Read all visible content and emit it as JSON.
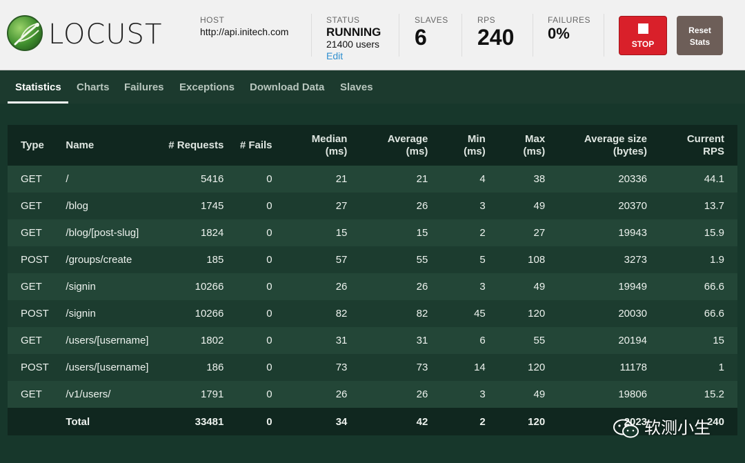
{
  "header": {
    "app_name": "LOCUST",
    "host": {
      "label": "HOST",
      "value": "http://api.initech.com"
    },
    "status": {
      "label": "STATUS",
      "state": "RUNNING",
      "users": "21400 users",
      "edit_label": "Edit"
    },
    "slaves": {
      "label": "SLAVES",
      "value": "6"
    },
    "rps": {
      "label": "RPS",
      "value": "240"
    },
    "failures": {
      "label": "FAILURES",
      "value": "0%"
    },
    "stop_label": "STOP",
    "reset_label_line1": "Reset",
    "reset_label_line2": "Stats"
  },
  "tabs": [
    {
      "label": "Statistics",
      "active": true
    },
    {
      "label": "Charts"
    },
    {
      "label": "Failures"
    },
    {
      "label": "Exceptions"
    },
    {
      "label": "Download Data"
    },
    {
      "label": "Slaves"
    }
  ],
  "table": {
    "columns": [
      {
        "line1": "Type",
        "line2": ""
      },
      {
        "line1": "Name",
        "line2": ""
      },
      {
        "line1": "# Requests",
        "line2": ""
      },
      {
        "line1": "# Fails",
        "line2": ""
      },
      {
        "line1": "Median",
        "line2": "(ms)"
      },
      {
        "line1": "Average",
        "line2": "(ms)"
      },
      {
        "line1": "Min",
        "line2": "(ms)"
      },
      {
        "line1": "Max",
        "line2": "(ms)"
      },
      {
        "line1": "Average size",
        "line2": "(bytes)"
      },
      {
        "line1": "Current",
        "line2": "RPS"
      }
    ],
    "rows": [
      [
        "GET",
        "/",
        "5416",
        "0",
        "21",
        "21",
        "4",
        "38",
        "20336",
        "44.1"
      ],
      [
        "GET",
        "/blog",
        "1745",
        "0",
        "27",
        "26",
        "3",
        "49",
        "20370",
        "13.7"
      ],
      [
        "GET",
        "/blog/[post-slug]",
        "1824",
        "0",
        "15",
        "15",
        "2",
        "27",
        "19943",
        "15.9"
      ],
      [
        "POST",
        "/groups/create",
        "185",
        "0",
        "57",
        "55",
        "5",
        "108",
        "3273",
        "1.9"
      ],
      [
        "GET",
        "/signin",
        "10266",
        "0",
        "26",
        "26",
        "3",
        "49",
        "19949",
        "66.6"
      ],
      [
        "POST",
        "/signin",
        "10266",
        "0",
        "82",
        "82",
        "45",
        "120",
        "20030",
        "66.6"
      ],
      [
        "GET",
        "/users/[username]",
        "1802",
        "0",
        "31",
        "31",
        "6",
        "55",
        "20194",
        "15"
      ],
      [
        "POST",
        "/users/[username]",
        "186",
        "0",
        "73",
        "73",
        "14",
        "120",
        "11178",
        "1"
      ],
      [
        "GET",
        "/v1/users/",
        "1791",
        "0",
        "26",
        "26",
        "3",
        "49",
        "19806",
        "15.2"
      ]
    ],
    "total": [
      "",
      "Total",
      "33481",
      "0",
      "34",
      "42",
      "2",
      "120",
      "2023",
      "240"
    ]
  },
  "watermark": "软测小生"
}
